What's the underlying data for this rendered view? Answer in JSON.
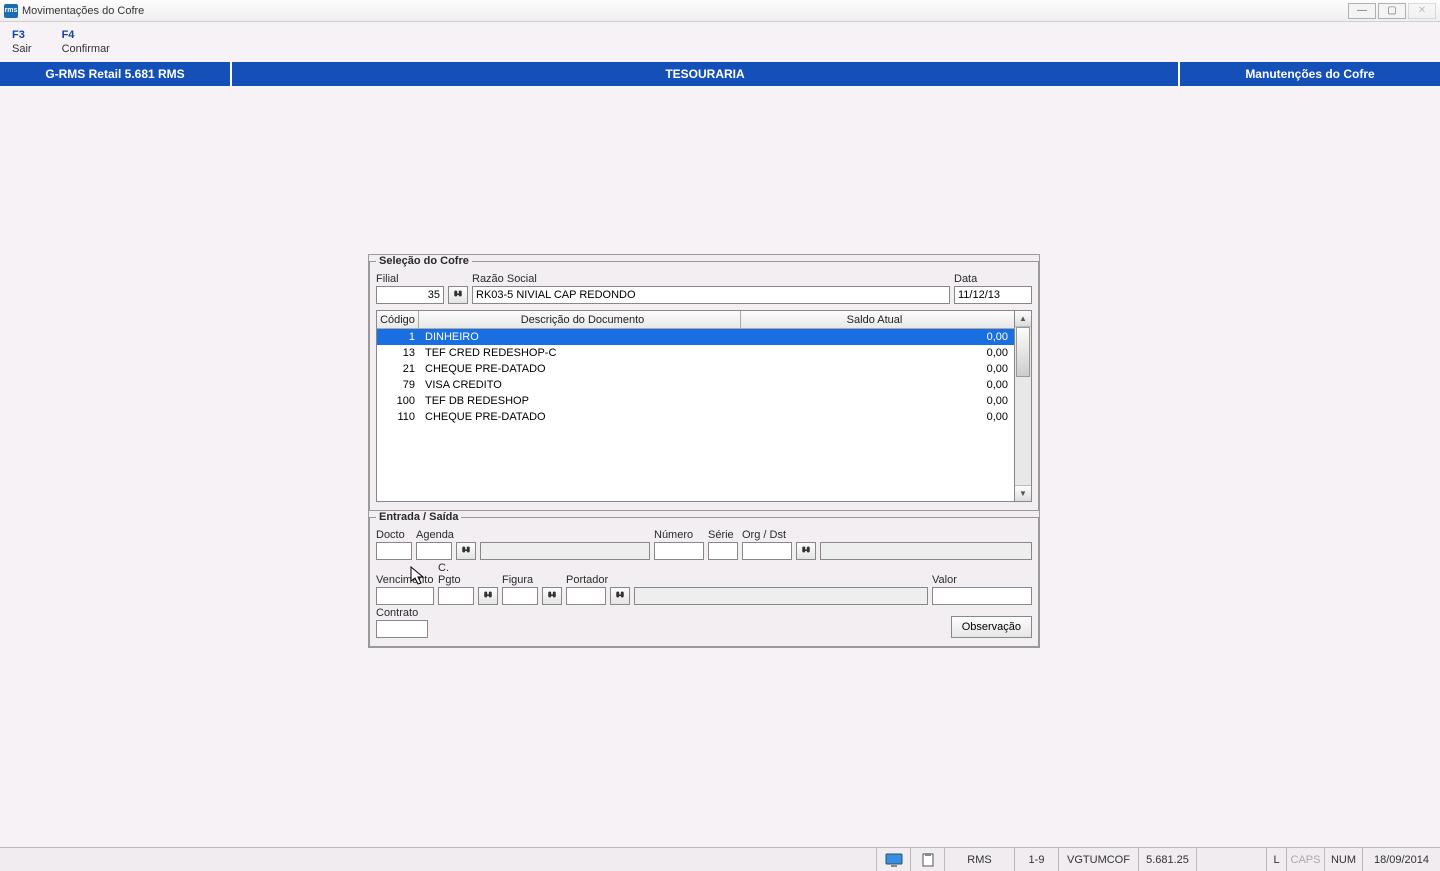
{
  "window": {
    "title": "Movimentações do Cofre",
    "app_icon_text": "rms"
  },
  "menu": {
    "f3": {
      "key": "F3",
      "label": "Sair"
    },
    "f4": {
      "key": "F4",
      "label": "Confirmar"
    }
  },
  "bluebar": {
    "left": "G-RMS Retail 5.681 RMS",
    "center": "TESOURARIA",
    "right": "Manutenções do Cofre"
  },
  "selecao": {
    "legend": "Seleção do Cofre",
    "labels": {
      "filial": "Filial",
      "razao": "Razão Social",
      "data": "Data"
    },
    "filial_value": "35",
    "razao_value": "RK03-5 NIVIAL CAP REDONDO",
    "data_value": "11/12/13"
  },
  "grid": {
    "headers": {
      "codigo": "Código",
      "desc": "Descrição do Documento",
      "saldo": "Saldo Atual"
    },
    "rows": [
      {
        "codigo": "1",
        "desc": "DINHEIRO",
        "saldo": "0,00",
        "selected": true
      },
      {
        "codigo": "13",
        "desc": "TEF CRED REDESHOP-C",
        "saldo": "0,00"
      },
      {
        "codigo": "21",
        "desc": "CHEQUE PRE-DATADO",
        "saldo": "0,00"
      },
      {
        "codigo": "79",
        "desc": "VISA CREDITO",
        "saldo": "0,00"
      },
      {
        "codigo": "100",
        "desc": "TEF DB REDESHOP",
        "saldo": "0,00"
      },
      {
        "codigo": "110",
        "desc": "CHEQUE PRE-DATADO",
        "saldo": "0,00"
      }
    ]
  },
  "entrada": {
    "legend": "Entrada / Saída",
    "labels": {
      "docto": "Docto",
      "agenda": "Agenda",
      "numero": "Número",
      "serie": "Série",
      "orgdst": "Org / Dst",
      "vencimento": "Vencimento",
      "cpgto": "C. Pgto",
      "figura": "Figura",
      "portador": "Portador",
      "valor": "Valor",
      "contrato": "Contrato"
    },
    "observacao": "Observação"
  },
  "status": {
    "rms": "RMS",
    "range": "1-9",
    "code": "VGTUMCOF",
    "version": "5.681.25",
    "L": "L",
    "caps": "CAPS",
    "num": "NUM",
    "date": "18/09/2014"
  }
}
